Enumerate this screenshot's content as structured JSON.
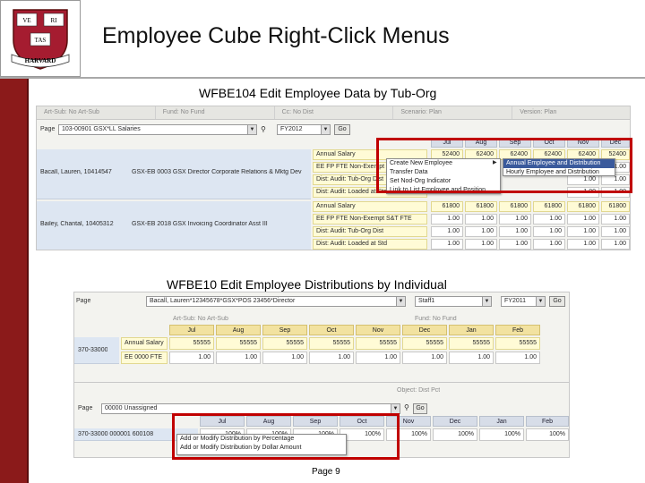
{
  "slide": {
    "title": "Employee Cube Right-Click Menus",
    "caption_top": "WFBE104 Edit Employee Data by Tub-Org",
    "caption_bottom": "WFBE10 Edit Employee Distributions by Individual",
    "page_number": "Page 9",
    "logo": {
      "letters": [
        "VE",
        "RI",
        "TAS"
      ],
      "banner": "HARVARD"
    }
  },
  "colors": {
    "accent_bar": "#8b1a1a",
    "highlight_box": "#c00000",
    "header_blue": "#d7dde8",
    "value_yellow": "#fffbd6",
    "menu_select": "#3a5a9c"
  },
  "screen1": {
    "toolbar": [
      "Art-Sub: No Art-Sub",
      "Fund: No Fund",
      "Cc: No Dist",
      "Scenario: Plan",
      "Version: Plan"
    ],
    "page_label": "Page",
    "page_select": "103-00901 GSX*LL Salaries",
    "year_select": "FY2012",
    "go_label": "Go",
    "months": [
      "Jul",
      "Aug",
      "Sep",
      "Oct",
      "Nov",
      "Dec"
    ],
    "employees": [
      {
        "name": "Bacall, Lauren, 10414547",
        "position": "GSX-EB 0003 GSX Director Corporate Relations & Mktg Dev",
        "measures": [
          "Annual Salary",
          "EE FP FTE Non-Exempt",
          "Dist: Audit: Tub-Org Dist",
          "Dist: Audit: Loaded at Std"
        ],
        "rows": [
          [
            "52400",
            "62400",
            "62400",
            "62400",
            "62400",
            "52400"
          ],
          [
            "",
            "",
            "",
            "",
            "",
            "1.00"
          ],
          [
            "",
            "",
            "",
            "",
            "1.00",
            "1.00"
          ],
          [
            "",
            "",
            "",
            "",
            "1.00",
            "1.00"
          ]
        ]
      },
      {
        "name": "Bailey, Chantal, 10405312",
        "position": "GSX-EB 2018 GSX Invoicing Coordinator Asst III",
        "measures": [
          "Annual Salary",
          "EE FP FTE Non-Exempt S&T FTE",
          "Dist: Audit: Tub-Org Dist",
          "Dist: Audit: Loaded at Std"
        ],
        "rows": [
          [
            "61800",
            "61800",
            "61800",
            "61800",
            "61800",
            "61800"
          ],
          [
            "1.00",
            "1.00",
            "1.00",
            "1.00",
            "1.00",
            "1.00"
          ],
          [
            "1.00",
            "1.00",
            "1.00",
            "1.00",
            "1.00",
            "1.00"
          ],
          [
            "1.00",
            "1.00",
            "1.00",
            "1.00",
            "1.00",
            "1.00"
          ]
        ]
      }
    ],
    "context_menu": {
      "items": [
        "Create New Employee",
        "Transfer Data",
        "Set Nod-Org Indicator",
        "Link to List Employee and Position"
      ],
      "submenu": [
        "Annual Employee and Distribution",
        "Hourly Employee and Distribution"
      ]
    }
  },
  "screen2": {
    "page_label": "Page",
    "page_select": "Bacall, Lauren*12345678*GSX*POS 23456*Director",
    "staff_select": "Staff1",
    "year_select": "FY2011",
    "go_label": "Go",
    "pov1": "Art-Sub: No Art-Sub",
    "pov2": "Fund: No Fund",
    "months": [
      "Jul",
      "Aug",
      "Sep",
      "Oct",
      "Nov",
      "Dec",
      "Jan",
      "Feb"
    ],
    "org": "370-33000",
    "measures": [
      "Annual Salary",
      "EE 0000 FTE"
    ],
    "rows": [
      [
        "55555",
        "55555",
        "55555",
        "55555",
        "55555",
        "55555",
        "55555",
        "55555"
      ],
      [
        "1.00",
        "1.00",
        "1.00",
        "1.00",
        "1.00",
        "1.00",
        "1.00",
        "1.00"
      ]
    ],
    "pov3": "Object: Dist Pct",
    "page2_select": "00000 Unassigned",
    "dist_row_label": "370-33000 000001 600108",
    "dist_values": [
      "100%",
      "100%",
      "100%",
      "100%",
      "100%",
      "100%",
      "100%",
      "100%"
    ],
    "context_menu": {
      "items": [
        "Add or Modify Distribution by Percentage",
        "Add or Modify Distribution by Dollar Amount"
      ]
    }
  }
}
